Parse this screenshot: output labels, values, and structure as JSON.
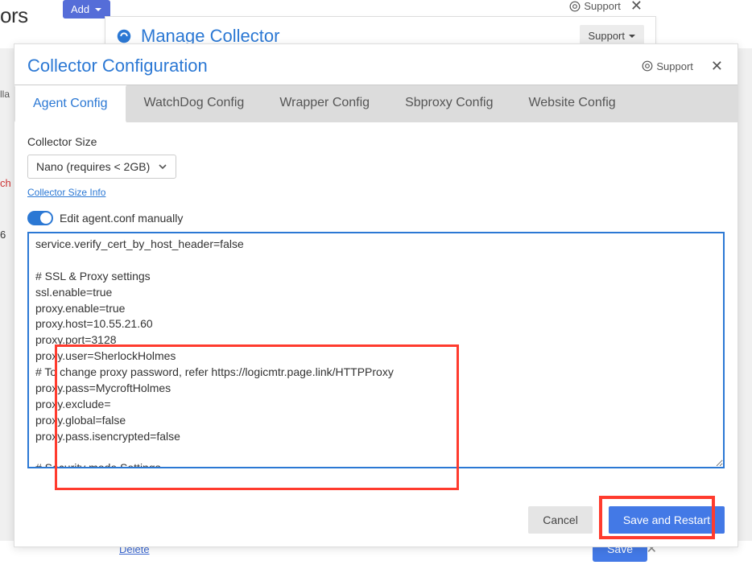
{
  "bg": {
    "ors": "ors",
    "add": "Add",
    "delete_text": "Delete",
    "save_text": "Save",
    "ch": "ch",
    "ll": "lla",
    "i6": "6"
  },
  "outer_modal": {
    "title": "Manage Collector",
    "support": "Support",
    "support_top": "Support"
  },
  "inner_modal": {
    "title": "Collector Configuration",
    "support_top": "Support"
  },
  "tabs": [
    {
      "label": "Agent Config",
      "active": true
    },
    {
      "label": "WatchDog Config",
      "active": false
    },
    {
      "label": "Wrapper Config",
      "active": false
    },
    {
      "label": "Sbproxy Config",
      "active": false
    },
    {
      "label": "Website Config",
      "active": false
    }
  ],
  "agent_tab": {
    "size_label": "Collector Size",
    "size_value": "Nano (requires < 2GB)",
    "size_info": "Collector Size Info",
    "toggle_label": "Edit agent.conf manually",
    "conf_text": "service.verify_cert_by_host_header=false\n\n# SSL & Proxy settings\nssl.enable=true\nproxy.enable=true\nproxy.host=10.55.21.60\nproxy.port=3128\nproxy.user=SherlockHolmes\n# To change proxy password, refer https://logicmtr.page.link/HTTPProxy\nproxy.pass=MycroftHolmes\nproxy.exclude=\nproxy.global=false\nproxy.pass.isencrypted=false\n\n# Security mode Settings\n# Select either HSM or OCM. OCM is default\ncollector.security.mode=OCM\n# Collector sets the respective mode to true based on collector.security.mode\nhsm.enabled=false"
  },
  "footer": {
    "cancel": "Cancel",
    "save_restart": "Save and Restart"
  }
}
